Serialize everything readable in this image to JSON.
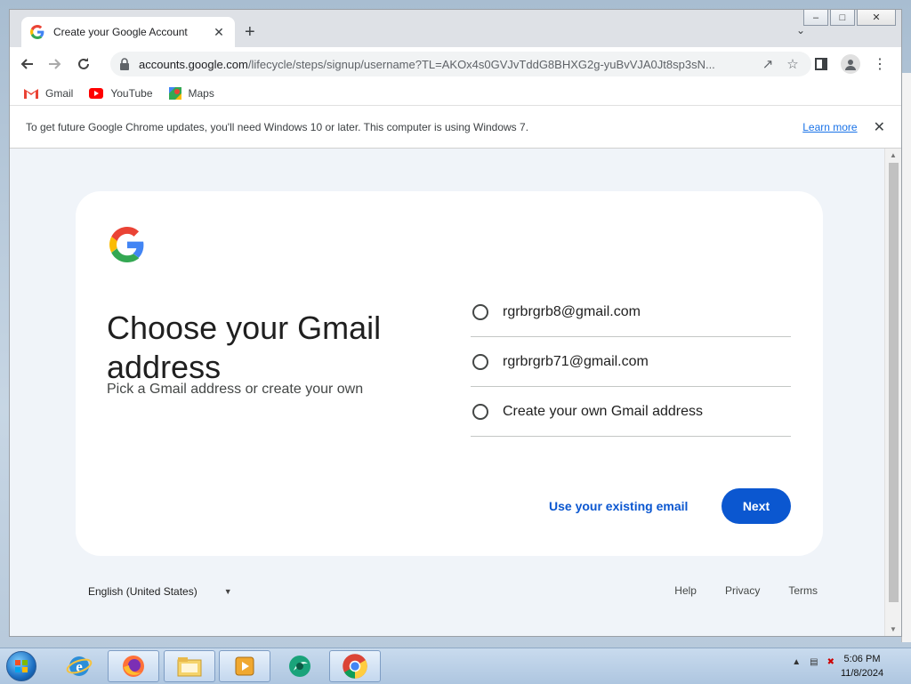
{
  "browser": {
    "tab_title": "Create your Google Account",
    "tab_close": "✕",
    "new_tab": "+",
    "url_host": "accounts.google.com",
    "url_path": "/lifecycle/steps/signup/username?TL=AKOx4s0GVJvTddG8BHXG2g-yuBvVJA0Jt8sp3sN...",
    "bookmarks": [
      {
        "label": "Gmail",
        "icon": "gmail-icon"
      },
      {
        "label": "YouTube",
        "icon": "youtube-icon"
      },
      {
        "label": "Maps",
        "icon": "maps-icon"
      }
    ],
    "infobar": {
      "message": "To get future Google Chrome updates, you'll need Windows 10 or later. This computer is using Windows 7.",
      "learn_more": "Learn more",
      "close": "✕"
    }
  },
  "signup": {
    "heading": "Choose your Gmail address",
    "subtitle": "Pick a Gmail address or create your own",
    "options": [
      {
        "label": "rgrbrgrb8@gmail.com"
      },
      {
        "label": "rgrbrgrb71@gmail.com"
      },
      {
        "label": "Create your own Gmail address"
      }
    ],
    "secondary_action": "Use your existing email",
    "primary_action": "Next",
    "brand_colors": {
      "blue": "#4285F4",
      "red": "#EA4335",
      "yellow": "#FBBC05",
      "green": "#34A853",
      "button": "#0b57d0"
    }
  },
  "footer": {
    "language": "English (United States)",
    "links": [
      "Help",
      "Privacy",
      "Terms"
    ]
  },
  "taskbar": {
    "time": "5:06 PM",
    "date": "11/8/2024",
    "apps": [
      "internet-explorer-icon",
      "firefox-icon",
      "file-explorer-icon",
      "media-player-icon",
      "app-icon",
      "chrome-icon"
    ]
  }
}
